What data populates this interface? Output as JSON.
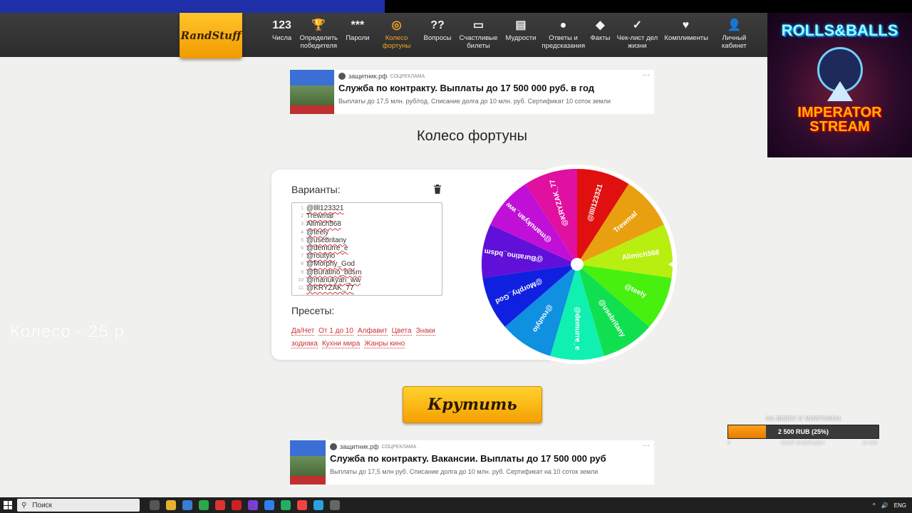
{
  "nav": {
    "logo": "RandStuff",
    "items": [
      {
        "icon": "123",
        "label": "Числа",
        "icon_name": "numbers-icon"
      },
      {
        "icon": "🏆",
        "label": "Определить победителя",
        "icon_name": "trophy-icon"
      },
      {
        "icon": "***",
        "label": "Пароли",
        "icon_name": "password-icon"
      },
      {
        "icon": "◎",
        "label": "Колесо фортуны",
        "icon_name": "wheel-icon",
        "active": true
      },
      {
        "icon": "??",
        "label": "Вопросы",
        "icon_name": "question-icon"
      },
      {
        "icon": "▭",
        "label": "Счастливые билеты",
        "icon_name": "ticket-icon"
      },
      {
        "icon": "▤",
        "label": "Мудрости",
        "icon_name": "book-icon"
      },
      {
        "icon": "●",
        "label": "Ответы и предсказания",
        "icon_name": "magic-ball-icon"
      },
      {
        "icon": "◆",
        "label": "Факты",
        "icon_name": "fact-icon"
      },
      {
        "icon": "✓",
        "label": "Чек-лист дел жизни",
        "icon_name": "checklist-icon"
      },
      {
        "icon": "♥",
        "label": "Комплименты",
        "icon_name": "heart-icon"
      },
      {
        "icon": "👤",
        "label": "Личный кабинет",
        "icon_name": "user-icon"
      }
    ]
  },
  "stream_art": {
    "title1": "ROLLS&BALLS",
    "title2a": "IMPERATOR",
    "title2b": "STREAM"
  },
  "ad_top": {
    "source": "защитник.рф",
    "tag": "СОЦРЕКЛАМА",
    "headline": "Служба по контракту. Выплаты до 17 500 000 руб. в год",
    "description": "Выплаты до 17,5 млн. руб/год. Списание долга до 10 млн. руб. Сертификат 10 соток земли",
    "more": "···"
  },
  "ad_bottom": {
    "source": "защитник.рф",
    "tag": "СОЦРЕКЛАМА",
    "headline": "Служба по контракту. Вакансии. Выплаты до 17 500 000 руб",
    "description": "Выплаты до 17,5 млн руб. Списание долга до 10 млн. руб. Сертификат на 10 соток земли",
    "more": "···"
  },
  "page_title": "Колесо фортуны",
  "variants_label": "Варианты:",
  "variants": [
    "@llll123321",
    "Trewmal",
    "Alimich568",
    "@teely",
    "@usebritany",
    "@demurre_e",
    "@routyio",
    "@Morphy_God",
    "@Buratino_bdsm",
    "@manukyan_ww",
    "@KRYZAK_77"
  ],
  "presets_label": "Пресеты:",
  "presets": [
    "Да/Нет",
    "От 1 до 10",
    "Алфавит",
    "Цвета",
    "Знаки зодиака",
    "Кухни мира",
    "Жанры кино"
  ],
  "wheel": {
    "segments": [
      {
        "label": "@llll123321",
        "color": "#e01010"
      },
      {
        "label": "Trewmal",
        "color": "#e8a010"
      },
      {
        "label": "Alimich568",
        "color": "#b8ee10"
      },
      {
        "label": "@teely",
        "color": "#48f010"
      },
      {
        "label": "@usebritany",
        "color": "#10e050"
      },
      {
        "label": "@demurre_e",
        "color": "#10f0b0"
      },
      {
        "label": "@routyio",
        "color": "#1090e0"
      },
      {
        "label": "@Morphy_God",
        "color": "#1020e0"
      },
      {
        "label": "@Buratino_bdsm",
        "color": "#6010d8"
      },
      {
        "label": "@manukyan_ww",
        "color": "#c010d8"
      },
      {
        "label": "@KRYZAK_77",
        "color": "#e010a0"
      }
    ]
  },
  "spin_label": "Крутить",
  "overlay_text": "Колесо - 25 р",
  "donation": {
    "title": "НА ВЕБКУ И МИКРОФОН",
    "amount_text": "2 500 RUB (25%)",
    "progress": 0.25,
    "min": "0",
    "max": "10 000",
    "mid": "СБОР ЗАВЕРШЕН"
  },
  "taskbar": {
    "search_placeholder": "Поиск",
    "lang": "ENG"
  }
}
